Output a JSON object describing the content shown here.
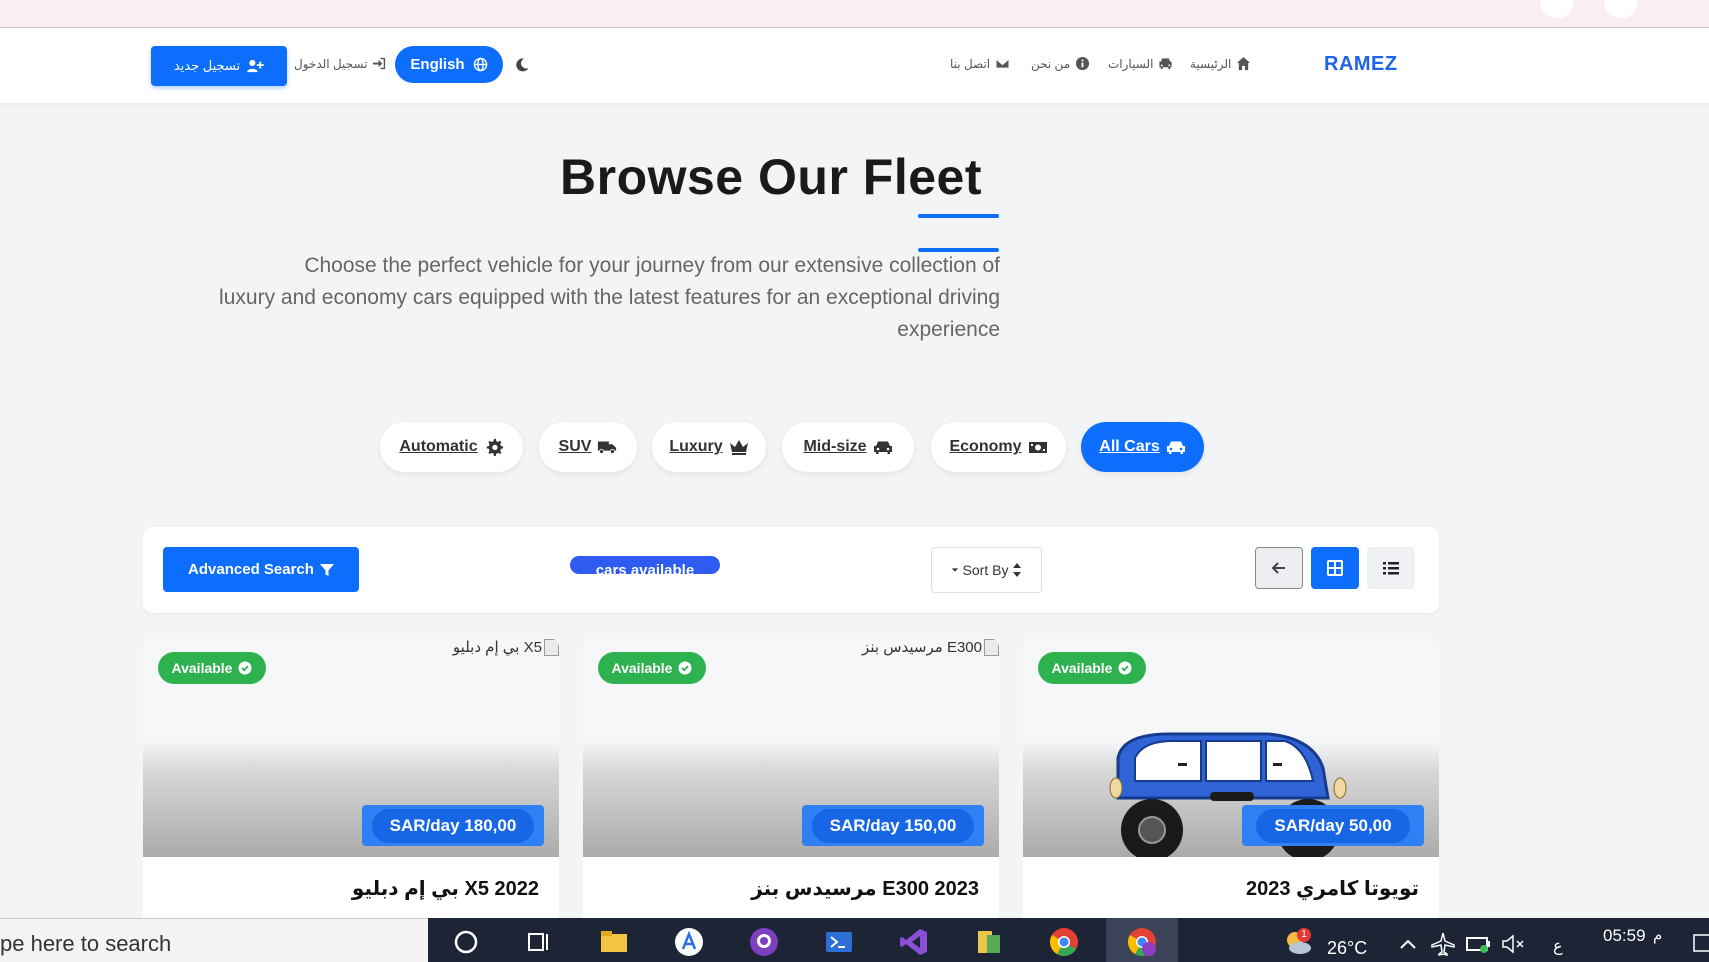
{
  "nav": {
    "brand": "RAMEZ",
    "links": [
      "الرئيسية",
      "السيارات",
      "من نحن",
      "اتصل بنا"
    ],
    "register": "تسجيل جديد",
    "login": "تسجيل الدخول",
    "language": "English"
  },
  "hero": {
    "title": "Browse Our Fleet",
    "description": "Choose the perfect vehicle for your journey from our extensive collection of luxury and economy cars equipped with the latest features for an exceptional driving experience"
  },
  "filters": [
    "Automatic",
    "SUV",
    "Luxury",
    "Mid-size",
    "Economy",
    "All Cars"
  ],
  "toolbar": {
    "advanced_search": "Advanced Search",
    "count_text": "cars available",
    "sort": "Sort By"
  },
  "cars": [
    {
      "alt": "بي إم دبليو X5",
      "status": "Available",
      "price": "SAR/day 180,00",
      "title": "بي إم دبليو X5 2022"
    },
    {
      "alt": "مرسيدس بنز E300",
      "status": "Available",
      "price": "SAR/day 150,00",
      "title": "مرسيدس بنز E300 2023"
    },
    {
      "alt": "",
      "status": "Available",
      "price": "SAR/day 50,00",
      "title": "تويوتا كامري 2023"
    }
  ],
  "taskbar": {
    "search": "pe here to search",
    "weather": "26°C",
    "time": "05:59",
    "ampm": "م",
    "lang": "ع",
    "notif": "1"
  },
  "colors": {
    "primary": "#0d6efd",
    "success": "#2eb14f",
    "brand": "#1e63e9"
  }
}
